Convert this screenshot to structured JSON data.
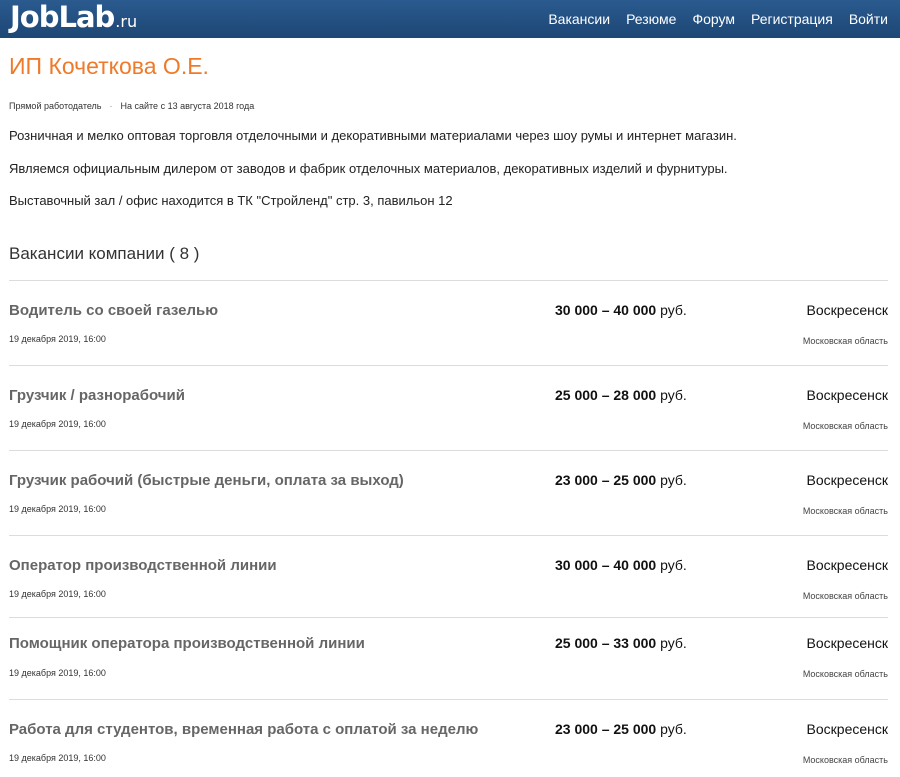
{
  "header": {
    "logo_main": "JobLab",
    "logo_tld": ".ru",
    "nav": [
      "Вакансии",
      "Резюме",
      "Форум",
      "Регистрация",
      "Войти"
    ]
  },
  "company": {
    "name": "ИП Кочеткова О.Е.",
    "type": "Прямой работодатель",
    "on_site": "На сайте с 13 августа 2018 года",
    "description": [
      "Розничная и мелко оптовая торговля отделочными и декоративными материалами через шоу румы и интернет магазин.",
      "Являемся официальным дилером от заводов и фабрик отделочных материалов, декоративных изделий и фурнитуры.",
      "Выставочный зал / офис находится в ТК \"Стройленд\" стр. 3, павильон 12"
    ]
  },
  "vacancies_heading": "Вакансии компании ( 8 )",
  "vacancies": [
    {
      "title": "Водитель со своей газелью",
      "salary": "30 000 – 40 000",
      "currency": "руб.",
      "city": "Воскресенск",
      "region": "Московская область",
      "date": "19 декабря 2019, 16:00"
    },
    {
      "title": "Грузчик / разнорабочий",
      "salary": "25 000 – 28 000",
      "currency": "руб.",
      "city": "Воскресенск",
      "region": "Московская область",
      "date": "19 декабря 2019, 16:00"
    },
    {
      "title": "Грузчик рабочий (быстрые деньги, оплата за выход)",
      "salary": "23 000 – 25 000",
      "currency": "руб.",
      "city": "Воскресенск",
      "region": "Московская область",
      "date": "19 декабря 2019, 16:00"
    },
    {
      "title": "Оператор производственной линии",
      "salary": "30 000 – 40 000",
      "currency": "руб.",
      "city": "Воскресенск",
      "region": "Московская область",
      "date": "19 декабря 2019, 16:00"
    },
    {
      "title": "Помощник оператора производственной линии",
      "salary": "25 000 – 33 000",
      "currency": "руб.",
      "city": "Воскресенск",
      "region": "Московская область",
      "date": "19 декабря 2019, 16:00"
    },
    {
      "title": "Работа для студентов, временная работа с оплатой за неделю",
      "salary": "23 000 – 25 000",
      "currency": "руб.",
      "city": "Воскресенск",
      "region": "Московская область",
      "date": "19 декабря 2019, 16:00"
    }
  ]
}
